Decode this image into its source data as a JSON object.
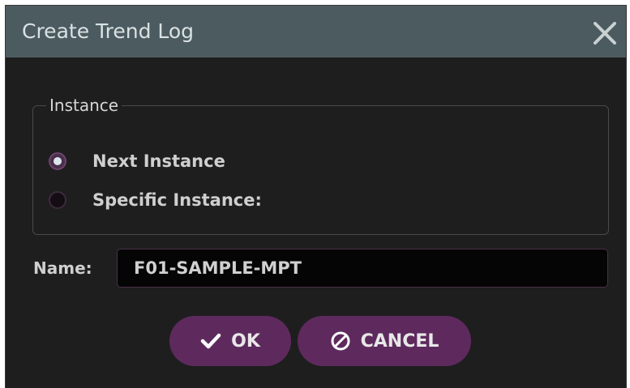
{
  "dialog": {
    "title": "Create Trend Log",
    "close_icon": "close-icon"
  },
  "instance": {
    "legend": "Instance",
    "options": [
      {
        "label": "Next Instance",
        "checked": true
      },
      {
        "label": "Specific Instance:",
        "checked": false
      }
    ]
  },
  "name": {
    "label": "Name:",
    "value": "F01-SAMPLE-MPT"
  },
  "buttons": {
    "ok_label": "OK",
    "ok_icon": "check-icon",
    "cancel_label": "CANCEL",
    "cancel_icon": "ban-icon"
  },
  "colors": {
    "titlebar": "#4c5b5f",
    "background": "#1e1e1e",
    "button": "#5e2a5e",
    "input_border": "#4a2f4a"
  }
}
